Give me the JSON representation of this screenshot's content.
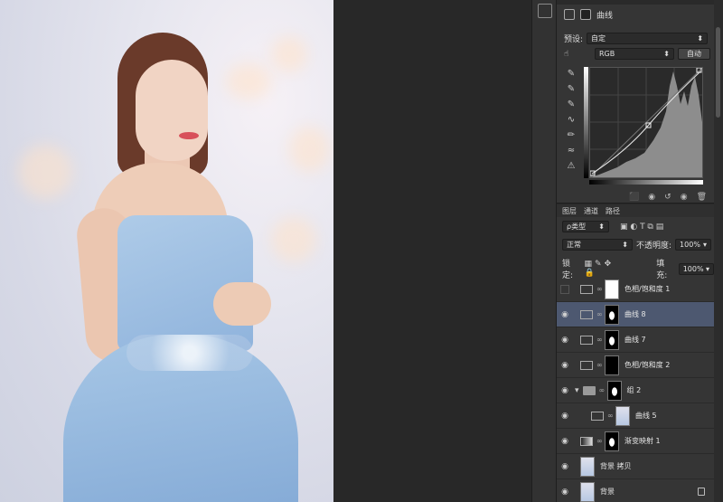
{
  "properties": {
    "title": "曲线",
    "preset_label": "预设:",
    "preset_value": "自定",
    "channel_value": "RGB",
    "auto_label": "自动"
  },
  "layers": {
    "tabs": [
      "图层",
      "通道",
      "路径"
    ],
    "kind_label": "ρ类型",
    "blend_mode": "正常",
    "opacity_label": "不透明度:",
    "opacity_value": "100%",
    "lock_label": "锁定:",
    "fill_label": "填充:",
    "fill_value": "100%",
    "items": [
      {
        "name": "色相/饱和度 1",
        "visible": false,
        "mask": "white"
      },
      {
        "name": "曲线 8",
        "visible": true,
        "mask": "blackshape",
        "selected": true
      },
      {
        "name": "曲线 7",
        "visible": true,
        "mask": "black"
      },
      {
        "name": "色相/饱和度 2",
        "visible": true,
        "mask": "black"
      },
      {
        "name": "组 2",
        "visible": true,
        "mask": "black",
        "group": true
      },
      {
        "name": "曲线 5",
        "visible": true,
        "mask": "photo"
      },
      {
        "name": "渐变映射 1",
        "visible": true,
        "mask": "black"
      },
      {
        "name": "背景 拷贝",
        "visible": true,
        "mask": "photo"
      },
      {
        "name": "背景",
        "visible": true,
        "mask": "photo",
        "locked": true
      }
    ]
  },
  "icons": {
    "curves": "curves-icon",
    "eye": "eye-icon",
    "link": "link-icon",
    "lock": "lock-icon",
    "folder": "folder-icon"
  }
}
